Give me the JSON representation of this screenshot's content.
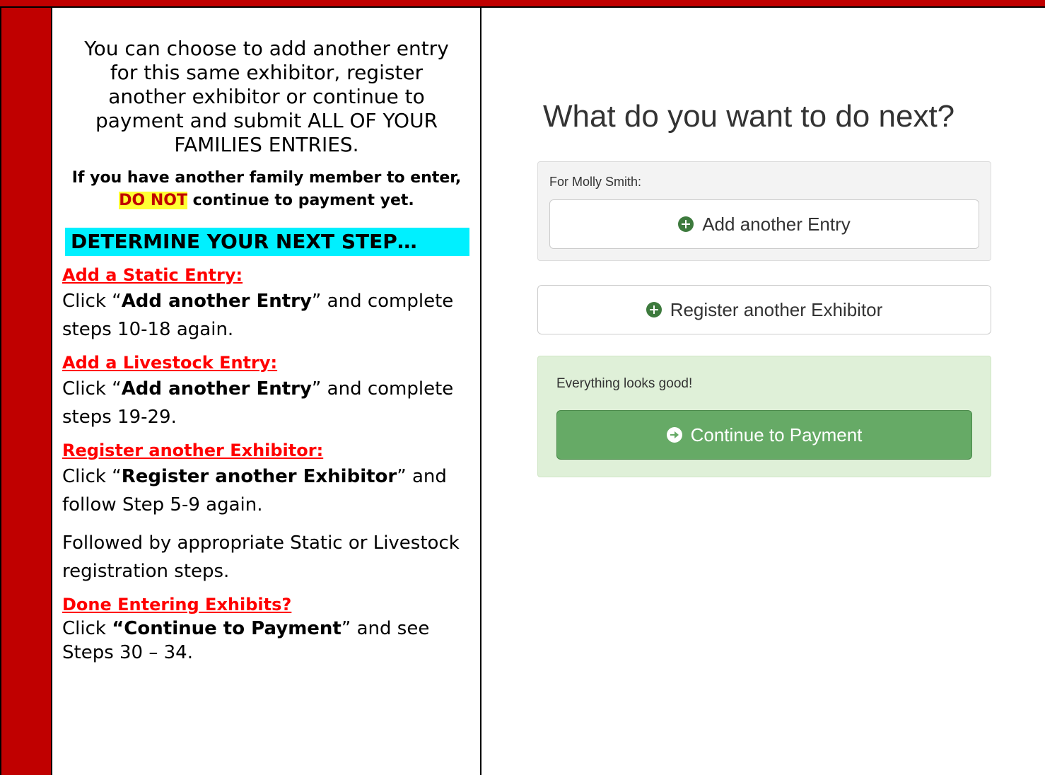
{
  "instructions": {
    "intro": "You can choose to add another entry for this same exhibitor, register another exhibitor or continue to payment and submit ALL OF YOUR FAMILIES ENTRIES.",
    "warning_before": "If you have another family member to enter, ",
    "warning_highlight": "DO NOT",
    "warning_after": " continue to payment yet.",
    "heading": "DETERMINE YOUR NEXT STEP…",
    "steps": [
      {
        "title": "Add a Static Entry:",
        "pre": "Click “",
        "bold": "Add another Entry",
        "post": "” and complete steps 10-18 again."
      },
      {
        "title": "Add a Livestock Entry:",
        "pre": "Click “",
        "bold": "Add another Entry",
        "post": "” and complete steps 19-29."
      },
      {
        "title": "Register another Exhibitor:",
        "pre": "Click “",
        "bold": "Register another Exhibitor",
        "post": "” and follow Step 5-9 again."
      }
    ],
    "followup": "Followed by appropriate Static or Livestock registration steps.",
    "final": {
      "title": "Done Entering Exhibits?",
      "pre": "Click ",
      "bold": "“Continue to Payment",
      "post": "” and see Steps 30 – 34."
    }
  },
  "screen": {
    "title": "What do you want to do next?",
    "exhibitor_label": "For Molly Smith:",
    "add_entry_label": "Add another Entry",
    "register_label": "Register another Exhibitor",
    "status_text": "Everything looks good!",
    "continue_label": "Continue to Payment"
  },
  "colors": {
    "frame_red": "#c00000",
    "heading_bg": "#00f0ff",
    "highlight_bg": "#ffff33",
    "link_red": "#ff0000",
    "success_bg": "#dff0d8",
    "success_btn": "#66aa66"
  },
  "icons": {
    "add_entry": "plus-circle-icon",
    "register": "plus-circle-icon",
    "continue": "arrow-circle-right-icon"
  }
}
